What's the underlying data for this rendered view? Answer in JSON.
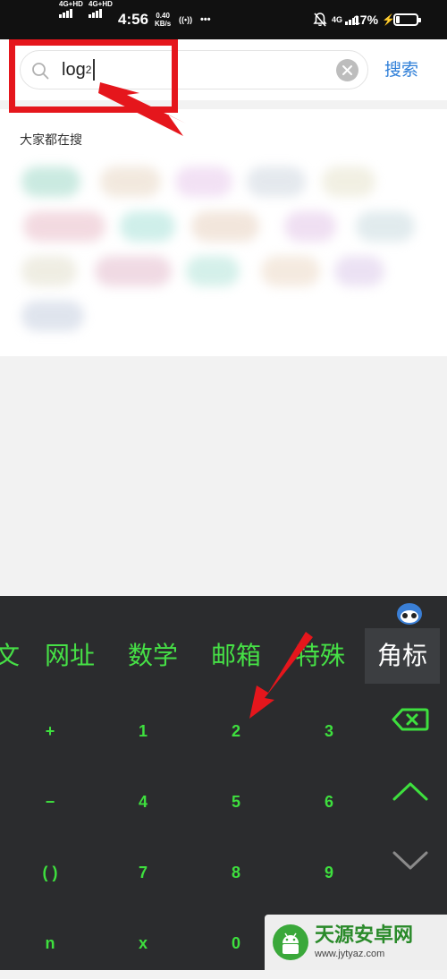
{
  "status_bar": {
    "net1": "4G+HD",
    "net2": "4G+HD",
    "time": "4:56",
    "speed_value": "0.40",
    "speed_unit": "KB/s",
    "hotspot_glyph": "((•))",
    "more_glyph": "•••",
    "mute_icon": "bell-off-icon",
    "net_right": "4G",
    "battery": "17%",
    "charging_glyph": "⚡"
  },
  "search": {
    "query_base": "log",
    "query_sub": "2",
    "button_label": "搜索"
  },
  "trending": {
    "title": "大家都在搜",
    "chip_colors": [
      "#9fd9c8",
      "#e8d7c4",
      "#e8c9ec",
      "#cfd7e0",
      "#e6e3cc",
      "#e9bcc8",
      "#a8e2d9",
      "#e8d2c0",
      "#e3c6e8",
      "#c9dbe0",
      "#e2dfcc",
      "#e4bccd",
      "#b2e4d9",
      "#ecd9c6",
      "#dccaea",
      "#c6cfe0"
    ]
  },
  "keyboard": {
    "tabs": [
      "文",
      "网址",
      "数学",
      "邮箱",
      "特殊",
      "角标"
    ],
    "active_tab": "角标",
    "keys": [
      [
        "+",
        "1",
        "2",
        "3"
      ],
      [
        "−",
        "4",
        "5",
        "6"
      ],
      [
        "( )",
        "7",
        "8",
        "9"
      ],
      [
        "n",
        "x",
        "0"
      ]
    ],
    "side_icons": [
      "backspace-icon",
      "chevron-up-icon",
      "chevron-down-icon"
    ],
    "accent_color": "#3ee03e"
  },
  "watermark": {
    "title": "天源安卓网",
    "url": "www.jytyaz.com"
  },
  "colors": {
    "annotation_red": "#e5161c",
    "link_blue": "#2f7fd8",
    "keyboard_bg": "#2b2c2e"
  }
}
